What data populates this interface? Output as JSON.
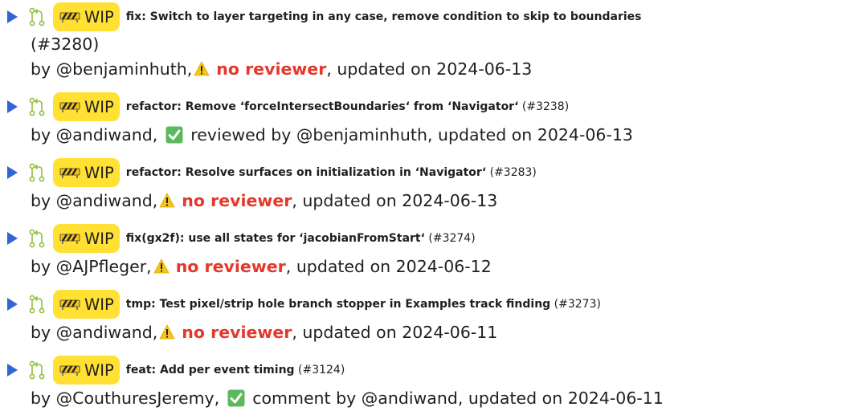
{
  "wip_label": "WIP",
  "colors": {
    "caret": "#2f66d6",
    "wip_badge": "#ffe033",
    "no_reviewer": "#e5382b",
    "check_green": "#5cb85c",
    "warning_yellow": "#f5c518"
  },
  "items": [
    {
      "title": "fix: Switch to layer targeting in any case, remove condition to skip to boundaries",
      "number": "(#3280)",
      "author": "@benjaminhuth,",
      "status_icon": "warning-icon",
      "status": "no reviewer",
      "updated": ", updated on 2024-06-13",
      "prefix": "by "
    },
    {
      "title": "refactor: Remove ‘forceIntersectBoundaries‘ from ‘Navigator‘",
      "number": "(#3238)",
      "author": "@andiwand,",
      "status_icon": "check-icon",
      "status": "reviewed by @benjaminhuth",
      "updated": ", updated on 2024-06-13",
      "prefix": "by "
    },
    {
      "title": "refactor: Resolve surfaces on initialization in ‘Navigator‘",
      "number": "(#3283)",
      "author": "@andiwand,",
      "status_icon": "warning-icon",
      "status": "no reviewer",
      "updated": ", updated on 2024-06-13",
      "prefix": "by "
    },
    {
      "title": "fix(gx2f): use all states for ‘jacobianFromStart‘",
      "number": "(#3274)",
      "author": "@AJPfleger,",
      "status_icon": "warning-icon",
      "status": "no reviewer",
      "updated": ", updated on 2024-06-12",
      "prefix": "by "
    },
    {
      "title": "tmp: Test pixel/strip hole branch stopper in Examples track finding",
      "number": "(#3273)",
      "author": "@andiwand,",
      "status_icon": "warning-icon",
      "status": "no reviewer",
      "updated": ", updated on 2024-06-11",
      "prefix": "by "
    },
    {
      "title": "feat: Add per event timing",
      "number": "(#3124)",
      "author": "@CouthuresJeremy,",
      "status_icon": "check-icon",
      "status": "comment by @andiwand",
      "updated": ", updated on 2024-06-11",
      "prefix": "by "
    }
  ]
}
